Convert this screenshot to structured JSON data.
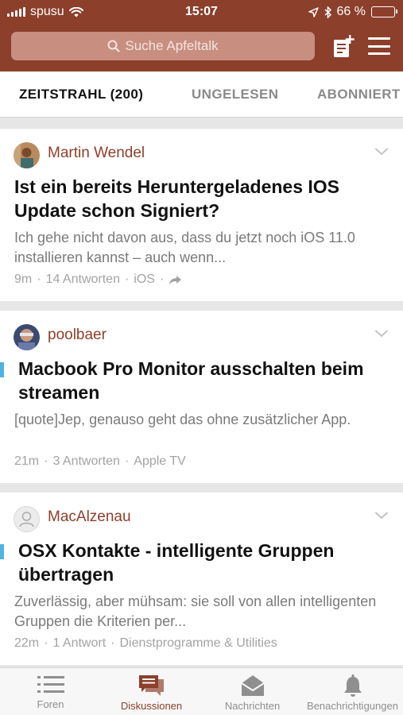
{
  "status_bar": {
    "carrier": "spusu",
    "time": "15:07",
    "battery": "66 %",
    "battery_level": 0.66
  },
  "header": {
    "search_placeholder": "Suche Apfeltalk",
    "compose_icon": "new-post-icon",
    "menu_icon": "hamburger-menu-icon",
    "color": "#8c3f2b"
  },
  "tabs": [
    {
      "label": "ZEITSTRAHL (200)",
      "active": true
    },
    {
      "label": "UNGELESEN",
      "active": false
    },
    {
      "label": "ABONNIERT",
      "active": false
    }
  ],
  "posts": [
    {
      "author": "Martin Wendel",
      "title": "Ist ein bereits Heruntergeladenes IOS Update schon Signiert?",
      "excerpt": "Ich gehe nicht davon aus, dass du jetzt noch iOS 11.0 installieren kannst – auch wenn...",
      "age": "9m",
      "replies": "14 Antworten",
      "forum": "iOS",
      "unread": false
    },
    {
      "author": "poolbaer",
      "title": "Macbook Pro Monitor ausschalten beim streamen",
      "excerpt": "[quote]Jep, genauso geht das ohne zusätzlicher App.",
      "age": "21m",
      "replies": "3 Antworten",
      "forum": "Apple TV",
      "unread": true
    },
    {
      "author": "MacAlzenau",
      "title": "OSX Kontakte - intelligente Gruppen übertragen",
      "excerpt": "Zuverlässig, aber mühsam: sie soll von allen intelligenten Gruppen die Kriterien per...",
      "age": "22m",
      "replies": "1 Antwort",
      "forum": "Dienstprogramme & Utilities",
      "unread": true
    }
  ],
  "meta_separator": "·",
  "tabbar": [
    {
      "label": "Foren",
      "icon": "list-icon",
      "active": false
    },
    {
      "label": "Diskussionen",
      "icon": "chat-bubbles-icon",
      "active": true
    },
    {
      "label": "Nachrichten",
      "icon": "envelope-icon",
      "active": false
    },
    {
      "label": "Benachrichtigungen",
      "icon": "bell-icon",
      "active": false
    }
  ]
}
